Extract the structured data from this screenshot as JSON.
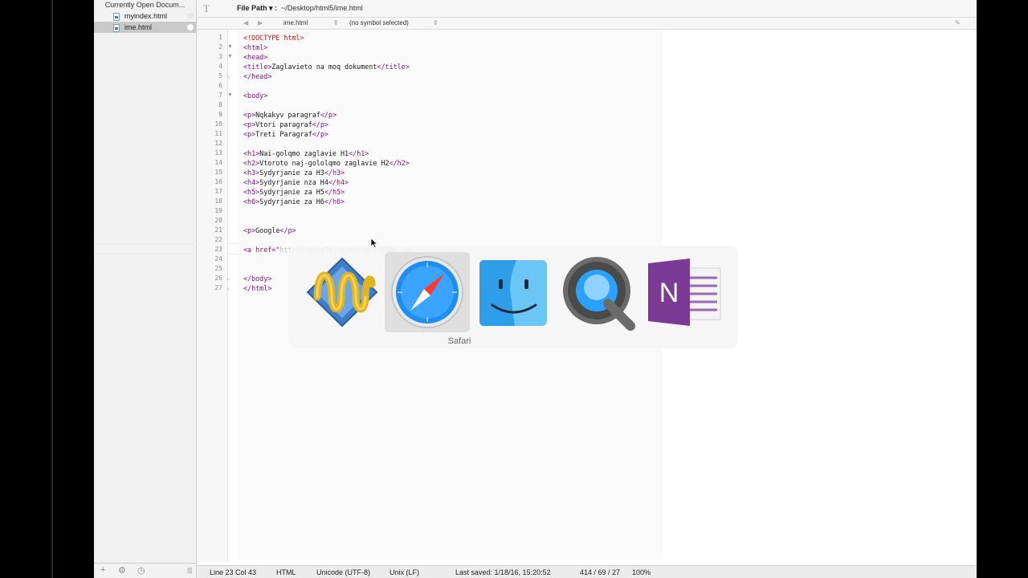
{
  "sidebar": {
    "header": "Currently Open Docum...",
    "items": [
      {
        "label": "myindex.html"
      },
      {
        "label": "ime.html"
      }
    ],
    "footer": {
      "add": "+",
      "gear": "⚙",
      "clock": "◷",
      "grip": "|||"
    }
  },
  "header": {
    "path_label": "File Path ▾ :",
    "path_value": "~/Desktop/html5/ime.html"
  },
  "navbar": {
    "back": "◀",
    "forward": "▶",
    "file": "ime.html",
    "symbol": "(no symbol selected)"
  },
  "editor": {
    "line_numbers": [
      "1",
      "2",
      "3",
      "4",
      "5",
      "6",
      "7",
      "8",
      "9",
      "10",
      "11",
      "12",
      "13",
      "14",
      "15",
      "16",
      "17",
      "18",
      "19",
      "20",
      "21",
      "22",
      "23",
      "24",
      "25",
      "26",
      "27"
    ],
    "lines": [
      "<!DOCTYPE html>",
      "<html>",
      "<head>",
      "<title>Zaglavieto na moq dokument</title>",
      "</head>",
      "",
      "<body>",
      "",
      "<p>Nqkakyv paragraf</p>",
      "<p>Vtori paragraf</p>",
      "<p>Treti Paragraf</p>",
      "",
      "<h1>Nai-golqmo zaglavie H1</h1>",
      "<h2>Vtoroto naj-gololqmo zaglavie H2</h2>",
      "<h3>Sydyrjanie za H3</h3>",
      "<h4>Sydyrjanie nza H4</h4>",
      "<h5>Sydyrjanie za H5</h5>",
      "<h6>Sydyrjanie za H6</h6>",
      "",
      "",
      "<p>Google</p>",
      "",
      "<a href=\"http://google.bg\">Google LINK</a>",
      "",
      "",
      "</body>",
      "</html>"
    ]
  },
  "switcher": {
    "apps": [
      {
        "name": "Sublime Text",
        "icon": "yarn-ball-icon"
      },
      {
        "name": "Safari",
        "icon": "safari-compass-icon"
      },
      {
        "name": "Finder",
        "icon": "finder-face-icon"
      },
      {
        "name": "QuickTime Player",
        "icon": "quicktime-icon"
      },
      {
        "name": "OneNote",
        "icon": "onenote-icon"
      }
    ],
    "selected_label": "Safari"
  },
  "statusbar": {
    "position": "Line 23 Col 43",
    "syntax": "HTML",
    "encoding": "Unicode (UTF-8)",
    "line_endings": "Unix (LF)",
    "last_saved": "Last saved: 1/18/16, 15:20:52",
    "counts": "414 / 69 / 27",
    "zoom": "100%"
  }
}
